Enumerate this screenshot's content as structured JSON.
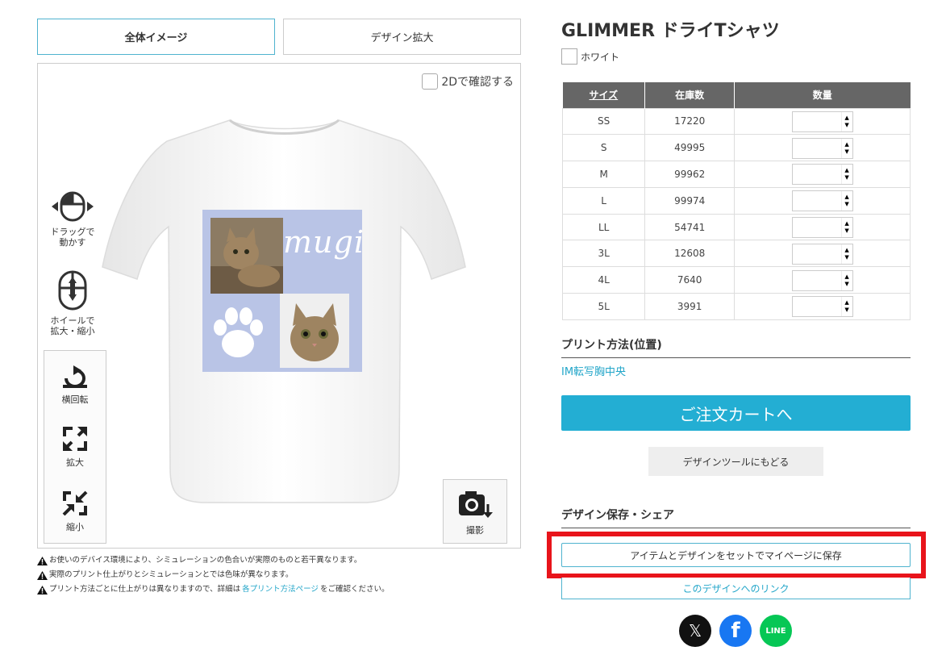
{
  "tabs": {
    "full_view": "全体イメージ",
    "design_zoom": "デザイン拡大"
  },
  "viewer": {
    "check_2d_label": "2Dで確認する",
    "design_text": "mugi",
    "drag_label": "ドラッグで\n動かす",
    "wheel_label": "ホイールで\n拡大・縮小",
    "tools": {
      "rotate": "横回転",
      "zoom_in": "拡大",
      "zoom_out": "縮小"
    },
    "capture_label": "撮影"
  },
  "notes": {
    "line1": "お使いのデバイス環境により、シミュレーションの色合いが実際のものと若干異なります。",
    "line2": "実際のプリント仕上がりとシミュレーションとでは色味が異なります。",
    "line3_pre": "プリント方法ごとに仕上がりは異なりますので、詳細は",
    "line3_link": "各プリント方法ページ",
    "line3_post": "をご確認ください。"
  },
  "product": {
    "title": "GLIMMER ドライTシャツ",
    "color": "ホワイト"
  },
  "stock_table": {
    "headers": {
      "size": "サイズ",
      "stock": "在庫数",
      "qty": "数量"
    },
    "rows": [
      {
        "size": "SS",
        "stock": "17220"
      },
      {
        "size": "S",
        "stock": "49995"
      },
      {
        "size": "M",
        "stock": "99962"
      },
      {
        "size": "L",
        "stock": "99974"
      },
      {
        "size": "LL",
        "stock": "54741"
      },
      {
        "size": "3L",
        "stock": "12608"
      },
      {
        "size": "4L",
        "stock": "7640"
      },
      {
        "size": "5L",
        "stock": "3991"
      }
    ]
  },
  "print": {
    "heading": "プリント方法(位置)",
    "value": "IM転写胸中央"
  },
  "actions": {
    "cart": "ご注文カートへ",
    "back": "デザインツールにもどる"
  },
  "share": {
    "heading": "デザイン保存・シェア",
    "save": "アイテムとデザインをセットでマイページに保存",
    "link": "このデザインへのリンク",
    "x": "𝕏",
    "facebook": "f",
    "line": "LINE"
  },
  "colors": {
    "accent": "#23aed3",
    "highlight": "#e8141b",
    "design_bg": "#b9c4e6"
  }
}
